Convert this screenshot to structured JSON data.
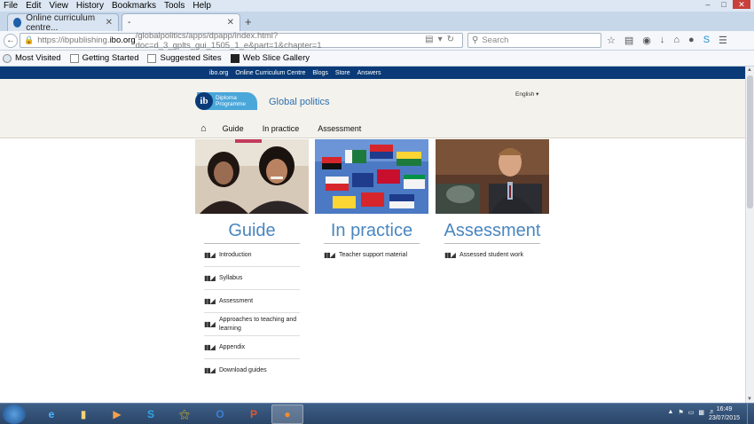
{
  "menu": [
    "File",
    "Edit",
    "View",
    "History",
    "Bookmarks",
    "Tools",
    "Help"
  ],
  "tabs": [
    {
      "title": "Online curriculum centre..."
    },
    {
      "title": "-"
    }
  ],
  "url": {
    "prefix": "https://ibpublishing.",
    "domain": "ibo.org",
    "path": "/globalpolitics/apps/dpapp/index.html?doc=d_3_gplts_gui_1505_1_e&part=1&chapter=1"
  },
  "search": {
    "placeholder": "Search"
  },
  "bookmarks": [
    "Most Visited",
    "Getting Started",
    "Suggested Sites",
    "Web Slice Gallery"
  ],
  "site": {
    "top_links": [
      "ibo.org",
      "Online Curriculum Centre",
      "Blogs",
      "Store",
      "Answers"
    ],
    "logo_line1": "Diploma",
    "logo_line2": "Programme",
    "logo_badge": "ib",
    "title": "Global politics",
    "language": "English",
    "nav": [
      "Guide",
      "In practice",
      "Assessment"
    ]
  },
  "columns": [
    {
      "heading": "Guide",
      "items": [
        "Introduction",
        "Syllabus",
        "Assessment",
        "Approaches to teaching and learning",
        "Appendix",
        "Download guides"
      ]
    },
    {
      "heading": "In practice",
      "items": [
        "Teacher support material"
      ]
    },
    {
      "heading": "Assessment",
      "items": [
        "Assessed student work"
      ]
    }
  ],
  "clock": {
    "time": "16:49",
    "date": "23/07/2015"
  },
  "colors": {
    "header_blue": "#0a3b78",
    "heading_blue": "#4a86bf",
    "logo_blue": "#4aa7da"
  }
}
